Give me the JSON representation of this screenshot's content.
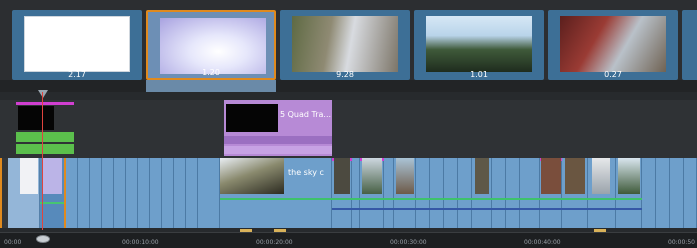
{
  "storyboard": {
    "thumbnails": [
      {
        "duration": "2.17",
        "image": "white-frame"
      },
      {
        "duration": "1.20",
        "image": "sky-frame",
        "selected": true
      },
      {
        "duration": "9.28",
        "image": "mirror-frame"
      },
      {
        "duration": "1.01",
        "image": "trees-frame"
      },
      {
        "duration": "0.27",
        "image": "road-frame"
      }
    ]
  },
  "timeline": {
    "title_clip_label": "5 Quad Tra...",
    "video_clip_label": "the sky c",
    "ruler": [
      "00:00",
      "00:00:10:00",
      "00:00:20:00",
      "00:00:30:00",
      "00:00:40:00",
      "00:00:50"
    ]
  },
  "colors": {
    "accent_selection": "#e08a1e",
    "clip_blue": "#6e9fcb",
    "marker_magenta": "#d13fd1",
    "audio_green": "#3ec26b",
    "title_purple": "#b78ad6",
    "playhead_red": "#e0443e"
  }
}
